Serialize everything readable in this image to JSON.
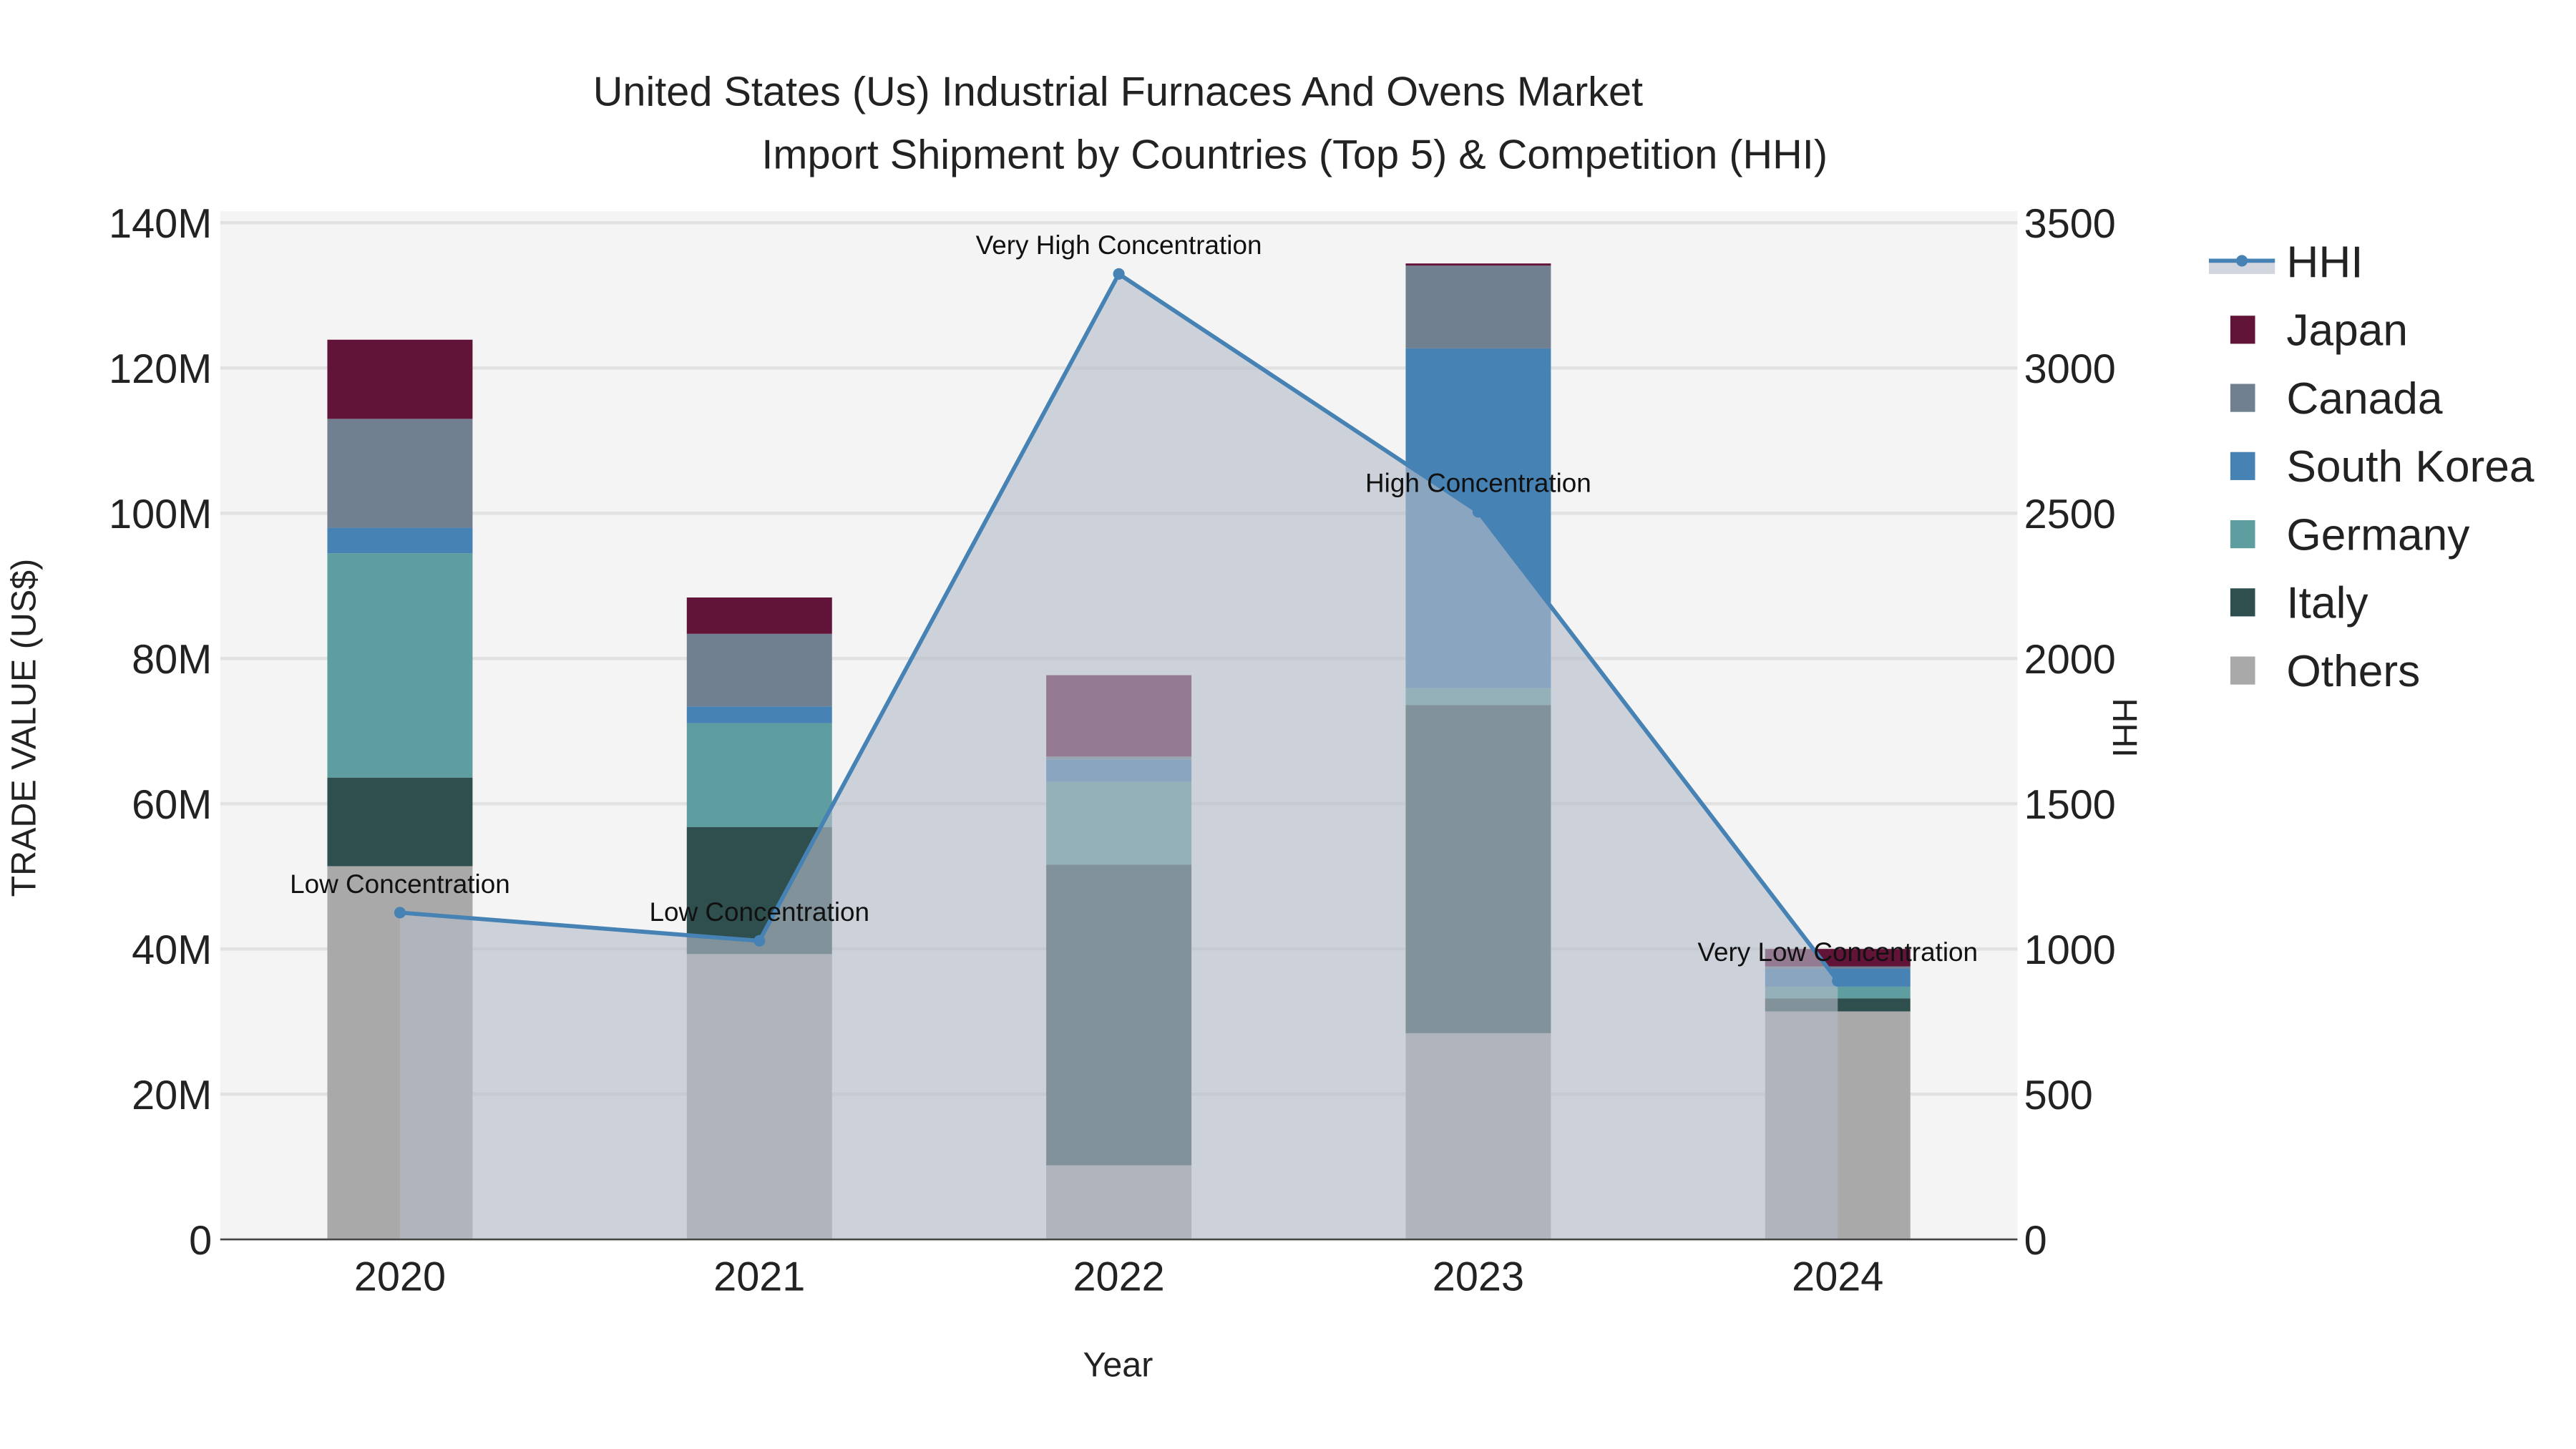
{
  "chart_data": {
    "type": "bar",
    "stacked": true,
    "title_line1": "United States (Us) Industrial Furnaces And Ovens Market",
    "title_line2": "Import Shipment by Countries (Top 5) & Competition (HHI)",
    "xlabel": "Year",
    "ylabel": "TRADE VALUE (US$)",
    "y2label": "HHI",
    "categories": [
      "2020",
      "2021",
      "2022",
      "2023",
      "2024"
    ],
    "ylim": [
      0,
      140000000
    ],
    "y_ticks": [
      0,
      20000000,
      40000000,
      60000000,
      80000000,
      100000000,
      120000000,
      140000000
    ],
    "y_tick_labels": [
      "0",
      "20M",
      "40M",
      "60M",
      "80M",
      "100M",
      "120M",
      "140M"
    ],
    "y2lim": [
      0,
      3500
    ],
    "y2_ticks": [
      0,
      500,
      1000,
      1500,
      2000,
      2500,
      3000,
      3500
    ],
    "y2_tick_labels": [
      "0",
      "500",
      "1000",
      "1500",
      "2000",
      "2500",
      "3000",
      "3500"
    ],
    "grid": true,
    "legend_position": "right",
    "series": [
      {
        "name": "Others",
        "color": "#A9A9A9",
        "values": [
          51400000,
          39300000,
          10200000,
          28400000,
          31400000
        ]
      },
      {
        "name": "Italy",
        "color": "#2F4F4F",
        "values": [
          12200000,
          17500000,
          41400000,
          45200000,
          1800000
        ]
      },
      {
        "name": "Germany",
        "color": "#5F9EA0",
        "values": [
          30900000,
          14300000,
          11400000,
          2300000,
          1600000
        ]
      },
      {
        "name": "South Korea",
        "color": "#4682B4",
        "values": [
          3500000,
          2300000,
          3100000,
          46800000,
          2500000
        ]
      },
      {
        "name": "Canada",
        "color": "#708090",
        "values": [
          15000000,
          10000000,
          400000,
          11400000,
          300000
        ]
      },
      {
        "name": "Japan",
        "color": "#621338",
        "values": [
          10900000,
          5000000,
          11200000,
          300000,
          2400000
        ]
      }
    ],
    "hhi": {
      "name": "HHI",
      "color": "#4682B4",
      "values": [
        1125,
        1028,
        3324,
        2505,
        890
      ],
      "annotations": [
        "Low Concentration",
        "Low Concentration",
        "Very High Concentration",
        "High Concentration",
        "Very Low Concentration"
      ]
    },
    "legend_order": [
      "HHI",
      "Japan",
      "Canada",
      "South Korea",
      "Germany",
      "Italy",
      "Others"
    ]
  }
}
